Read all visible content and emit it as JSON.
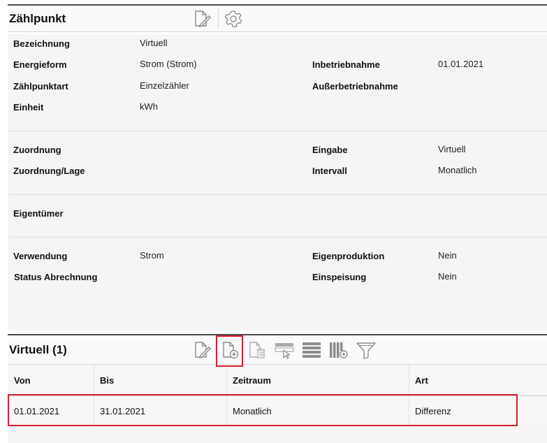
{
  "zaehlpunkt": {
    "title": "Zählpunkt",
    "toolbar": {
      "edit_icon": "edit-document-icon",
      "settings_icon": "gear-icon"
    },
    "fields": {
      "bezeichnung": {
        "label": "Bezeichnung",
        "value": "Virtuell"
      },
      "energieform": {
        "label": "Energieform",
        "value": "Strom (Strom)"
      },
      "zaehlpunktart": {
        "label": "Zählpunktart",
        "value": "Einzelzähler"
      },
      "einheit": {
        "label": "Einheit",
        "value": "kWh"
      },
      "inbetriebnahme": {
        "label": "Inbetriebnahme",
        "value": "01.01.2021"
      },
      "ausserbetriebnahme": {
        "label": "Außerbetriebnahme",
        "value": ""
      },
      "zuordnung": {
        "label": "Zuordnung",
        "value": ""
      },
      "zuordnung_lage": {
        "label": "Zuordnung/Lage",
        "value": ""
      },
      "eingabe": {
        "label": "Eingabe",
        "value": "Virtuell"
      },
      "intervall": {
        "label": "Intervall",
        "value": "Monatlich"
      },
      "eigentuemer": {
        "label": "Eigentümer",
        "value": ""
      },
      "verwendung": {
        "label": "Verwendung",
        "value": "Strom"
      },
      "status_abrechnung": {
        "label": "Status Abrechnung",
        "value": ""
      },
      "eigenproduktion": {
        "label": "Eigenproduktion",
        "value": "Nein"
      },
      "einspeisung": {
        "label": "Einspeisung",
        "value": "Nein"
      }
    }
  },
  "virtuell": {
    "title": "Virtuell (1)",
    "toolbar": {
      "edit_icon": "edit-document-icon",
      "add_icon": "add-document-icon",
      "delete_icon": "delete-document-icon",
      "select_icon": "row-select-icon",
      "rows_icon": "rows-icon",
      "columns_icon": "column-settings-icon",
      "filter_icon": "filter-icon"
    },
    "table": {
      "headers": [
        "Von",
        "Bis",
        "Zeitraum",
        "Art"
      ],
      "rows": [
        [
          "01.01.2021",
          "31.01.2021",
          "Monatlich",
          "Differenz"
        ]
      ]
    }
  },
  "colors": {
    "highlight": "#d8202d",
    "header_border": "#4a4a4a",
    "panel_bg": "#f5f5f5",
    "icon_gray": "#8c8c8c"
  }
}
